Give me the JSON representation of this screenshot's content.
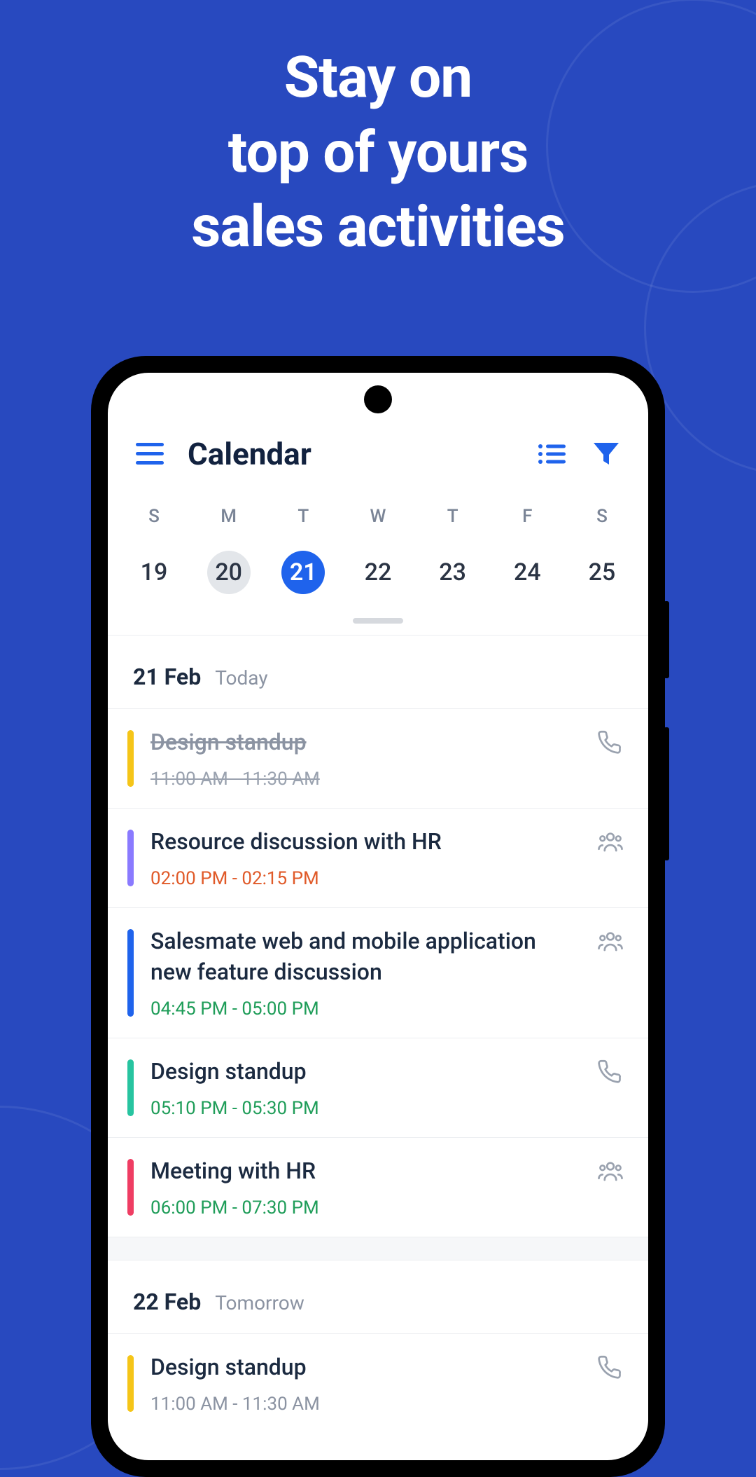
{
  "promo": {
    "line1": "Stay on",
    "line2": "top of yours",
    "line3": "sales activities"
  },
  "colors": {
    "accent": "#1f63ec"
  },
  "header": {
    "title": "Calendar"
  },
  "week": {
    "days": [
      {
        "letter": "S",
        "num": "19",
        "state": ""
      },
      {
        "letter": "M",
        "num": "20",
        "state": "today"
      },
      {
        "letter": "T",
        "num": "21",
        "state": "selected"
      },
      {
        "letter": "W",
        "num": "22",
        "state": ""
      },
      {
        "letter": "T",
        "num": "23",
        "state": ""
      },
      {
        "letter": "F",
        "num": "24",
        "state": ""
      },
      {
        "letter": "S",
        "num": "25",
        "state": ""
      }
    ]
  },
  "sections": [
    {
      "date": "21 Feb",
      "rel": "Today",
      "events": [
        {
          "title": "Design standup",
          "time": "11:00 AM  -  11:30 AM",
          "bar": "#f5c518",
          "timeClass": "done",
          "titleClass": "done",
          "icon": "phone"
        },
        {
          "title": "Resource discussion with HR",
          "time": "02:00 PM  -  02:15 PM",
          "bar": "#8a7aff",
          "timeClass": "soon",
          "titleClass": "",
          "icon": "people"
        },
        {
          "title": "Salesmate web and mobile application new feature discussion",
          "time": "04:45 PM  -  05:00 PM",
          "bar": "#1f63ec",
          "timeClass": "future",
          "titleClass": "",
          "icon": "people"
        },
        {
          "title": "Design standup",
          "time": "05:10 PM  -  05:30 PM",
          "bar": "#27c4a0",
          "timeClass": "future",
          "titleClass": "",
          "icon": "phone"
        },
        {
          "title": "Meeting with HR",
          "time": "06:00 PM  -  07:30 PM",
          "bar": "#ef3d63",
          "timeClass": "future",
          "titleClass": "",
          "icon": "people"
        }
      ]
    },
    {
      "date": "22 Feb",
      "rel": "Tomorrow",
      "events": [
        {
          "title": "Design standup",
          "time": "11:00 AM  -  11:30 AM",
          "bar": "#f5c518",
          "timeClass": "neutral",
          "titleClass": "",
          "icon": "phone"
        }
      ]
    }
  ]
}
